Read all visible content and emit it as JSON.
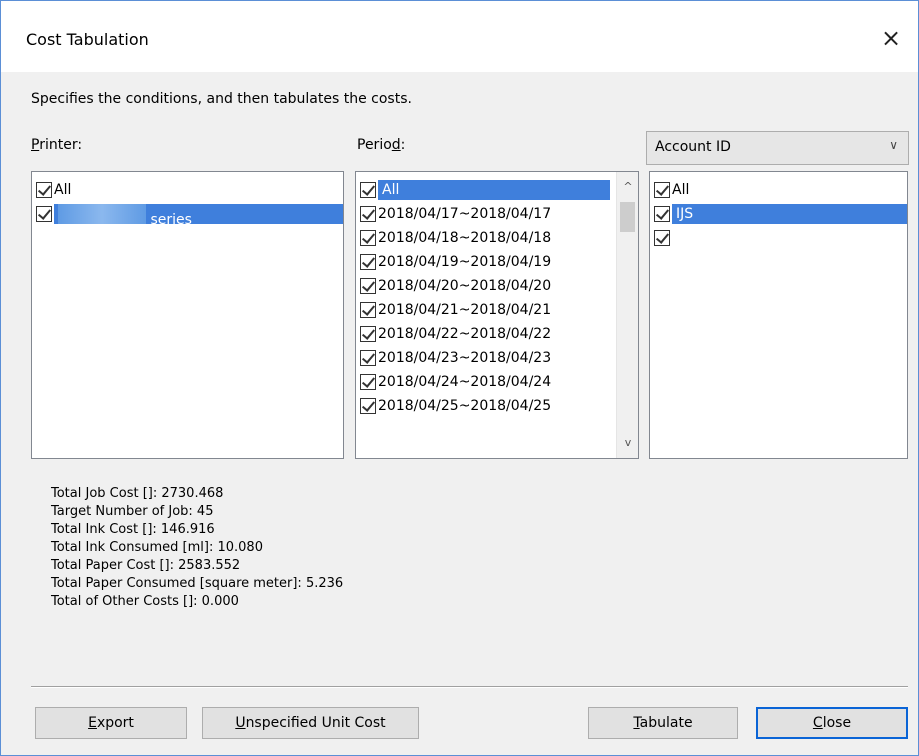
{
  "window": {
    "title": "Cost Tabulation",
    "close_glyph": "×"
  },
  "description": "Specifies the conditions, and then tabulates the costs.",
  "printer": {
    "label_mnemonic": "P",
    "label_rest": "rinter:",
    "items": [
      {
        "label": "All",
        "checked": true,
        "selected": false
      },
      {
        "label": "series",
        "checked": true,
        "selected": true
      }
    ]
  },
  "period": {
    "label_prefix": "Perio",
    "label_mnemonic": "d",
    "label_suffix": ":",
    "items": [
      {
        "label": "All",
        "checked": true,
        "selected": true
      },
      {
        "label": "2018/04/17~2018/04/17",
        "checked": true
      },
      {
        "label": "2018/04/18~2018/04/18",
        "checked": true
      },
      {
        "label": "2018/04/19~2018/04/19",
        "checked": true
      },
      {
        "label": "2018/04/20~2018/04/20",
        "checked": true
      },
      {
        "label": "2018/04/21~2018/04/21",
        "checked": true
      },
      {
        "label": "2018/04/22~2018/04/22",
        "checked": true
      },
      {
        "label": "2018/04/23~2018/04/23",
        "checked": true
      },
      {
        "label": "2018/04/24~2018/04/24",
        "checked": true
      },
      {
        "label": "2018/04/25~2018/04/25",
        "checked": true
      }
    ],
    "scroll_up": "^",
    "scroll_down": "v"
  },
  "account": {
    "dropdown_value": "Account ID",
    "dropdown_chevron": "∨",
    "items": [
      {
        "label": "All",
        "checked": true
      },
      {
        "label": "IJS",
        "checked": true,
        "selected": true
      },
      {
        "label": "",
        "checked": true
      }
    ]
  },
  "stats": [
    "Total Job Cost []: 2730.468",
    "Target Number of Job: 45",
    "Total Ink Cost []: 146.916",
    "Total Ink Consumed [ml]: 10.080",
    "Total Paper Cost []: 2583.552",
    "Total Paper Consumed [square meter]: 5.236",
    "Total of Other Costs []: 0.000"
  ],
  "buttons": {
    "export": {
      "mnemonic": "E",
      "rest": "xport"
    },
    "unspecified": {
      "mnemonic": "U",
      "rest": "nspecified Unit Cost"
    },
    "tabulate": {
      "mnemonic": "T",
      "rest": "abulate"
    },
    "close": {
      "mnemonic": "C",
      "rest": "lose"
    }
  },
  "colors": {
    "selection": "#3f7fdc",
    "focus_border": "#0a64d6",
    "window_border": "#5b8fd6"
  }
}
